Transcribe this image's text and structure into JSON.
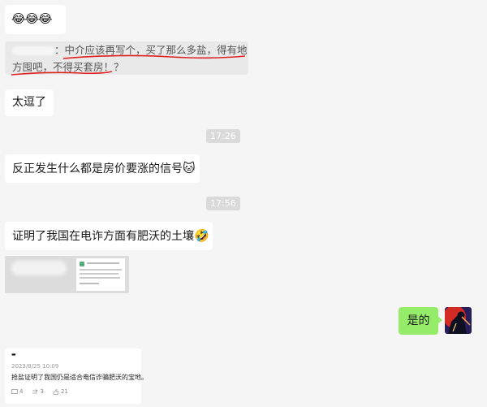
{
  "chat": {
    "first_message_emoji": "😂😂😂",
    "quote_sender": "",
    "quote_text_line1": "：中介应该再写个，买了那么多盐，得有地",
    "quote_text_line2": "方囤吧，不得买套房！？",
    "message2": "太逗了",
    "time1": "17:26",
    "message3": "反正发生什么都是房价要涨的信号",
    "message3_emoji": "🐱",
    "time2": "17:56",
    "message4": "证明了我国在电诈方面有肥沃的土壤",
    "message4_emoji": "🤣",
    "my_reply": "是的",
    "card": {
      "author": "▬",
      "date": "2023/8/25 10:09",
      "text": "抢盐证明了我国仍是适合电信诈骗肥沃的宝地。",
      "comments": "4",
      "reposts": "3",
      "likes": "21"
    }
  },
  "colors": {
    "my_bubble": "#95ec69",
    "underline": "#e02020",
    "background": "#f5f5f5"
  }
}
